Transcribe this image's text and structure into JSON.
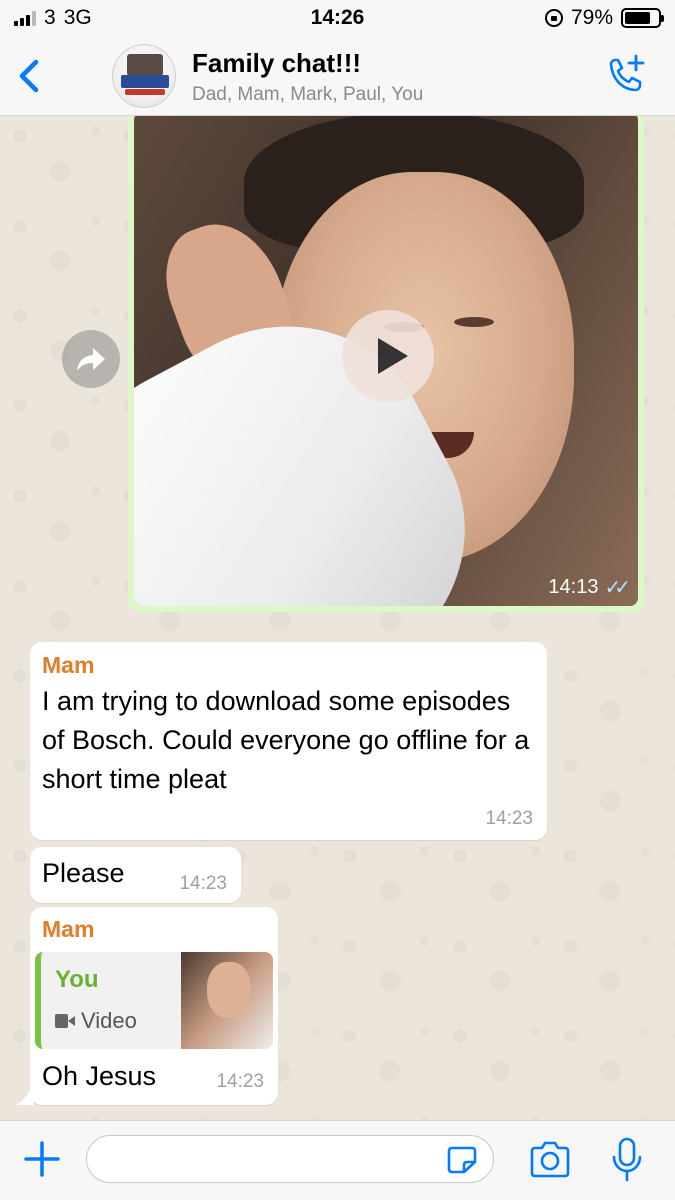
{
  "status_bar": {
    "carrier": "3",
    "network": "3G",
    "time": "14:26",
    "battery": "79%",
    "battery_level": 0.79
  },
  "header": {
    "title": "Family chat!!!",
    "members": "Dad, Mam, Mark, Paul, You",
    "avatar_icon": "group-avatar"
  },
  "messages": {
    "video": {
      "time": "14:13",
      "status_icon": "double-check-icon"
    },
    "mam1": {
      "sender": "Mam",
      "text": "I am trying to download some episodes of Bosch. Could everyone go offline for a short time pleat",
      "time": "14:23"
    },
    "please": {
      "text": "Please",
      "time": "14:23"
    },
    "mam2": {
      "sender": "Mam",
      "quote_sender": "You",
      "quote_type": "Video",
      "text": "Oh Jesus",
      "time": "14:23"
    }
  },
  "input": {
    "placeholder": ""
  },
  "colors": {
    "accent": "#007aff",
    "outgoing_bubble": "#dcf8c6",
    "sender_name": "#e27d2a",
    "quote_bar": "#7cc242",
    "read_ticks": "#b6e0ff"
  }
}
